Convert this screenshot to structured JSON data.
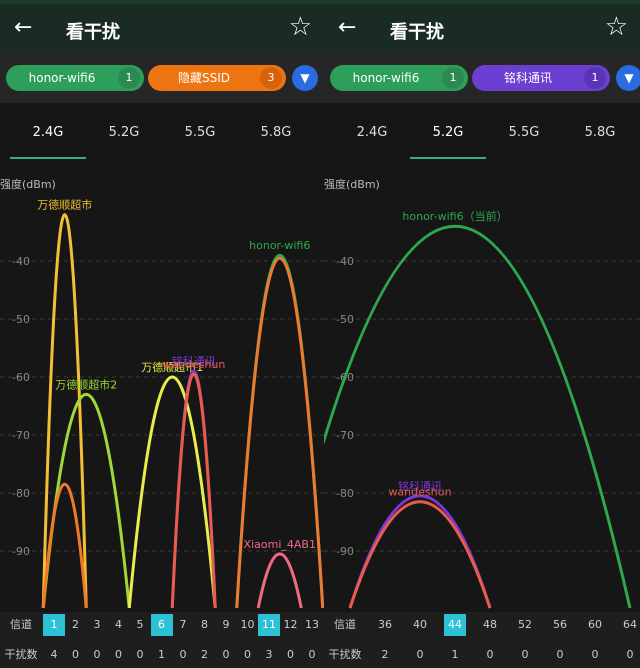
{
  "left": {
    "title": "看干扰",
    "chips": [
      {
        "label": "honor-wifi6",
        "count": "1",
        "color": "#2e9e5b",
        "badge": "#2b8a51"
      },
      {
        "label": "隐藏SSID",
        "count": "3",
        "color": "#ee7411",
        "badge": "#d6620a"
      }
    ],
    "tabs": [
      "2.4G",
      "5.2G",
      "5.5G",
      "5.8G"
    ],
    "active_tab": 0,
    "chart_data": {
      "type": "area",
      "ylabel": "强度(dBm)",
      "y_ticks": [
        "-40",
        "-50",
        "-60",
        "-70",
        "-80",
        "-90"
      ],
      "series": [
        {
          "name": "万德顺超市",
          "center": 1.5,
          "width": 2,
          "peak": -32,
          "color": "#f2c034"
        },
        {
          "name": "万德顺超市2",
          "center": 2.5,
          "width": 4,
          "peak": -63,
          "color": "#9ed839"
        },
        {
          "name": "",
          "center": 1.5,
          "width": 2,
          "peak": -78.5,
          "color": "#f07a28"
        },
        {
          "name": "万德顺超市1",
          "center": 6.5,
          "width": 4,
          "peak": -60,
          "color": "#e8ed4a"
        },
        {
          "name": "铭科通讯",
          "center": 7.5,
          "width": 2,
          "peak": -59,
          "color": "#7a38d8"
        },
        {
          "name": "wandeshun",
          "center": 7.5,
          "width": 2,
          "peak": -59.5,
          "color": "#e85c4a"
        },
        {
          "name": "honor-wifi6",
          "center": 11.5,
          "width": 4,
          "peak": -39,
          "color": "#2da84f"
        },
        {
          "name": "",
          "center": 11.5,
          "width": 4,
          "peak": -39.5,
          "color": "#ec7a30"
        },
        {
          "name": "Xiaomi_4AB1",
          "center": 11.5,
          "width": 2,
          "peak": -90.5,
          "color": "#f06a86"
        }
      ]
    },
    "row1_label": "信道",
    "row2_label": "干扰数",
    "channels": [
      "1",
      "2",
      "3",
      "4",
      "5",
      "6",
      "7",
      "8",
      "9",
      "10",
      "11",
      "12",
      "13"
    ],
    "interference": [
      "4",
      "0",
      "0",
      "0",
      "0",
      "1",
      "0",
      "2",
      "0",
      "0",
      "3",
      "0",
      "0"
    ],
    "highlight": [
      0,
      5,
      10
    ]
  },
  "right": {
    "title": "看干扰",
    "chips": [
      {
        "label": "honor-wifi6",
        "count": "1",
        "color": "#2e9e5b",
        "badge": "#2b8a51"
      },
      {
        "label": "铭科通讯",
        "count": "1",
        "color": "#6b3fd0",
        "badge": "#5c32b8"
      }
    ],
    "tabs": [
      "2.4G",
      "5.2G",
      "5.5G",
      "5.8G"
    ],
    "active_tab": 1,
    "chart_data": {
      "type": "area",
      "ylabel": "强度(dBm)",
      "y_ticks": [
        "-40",
        "-50",
        "-60",
        "-70",
        "-80",
        "-90"
      ],
      "series": [
        {
          "name": "honor-wifi6（当前）",
          "center": 44,
          "width": 40,
          "peak": -34,
          "color": "#2da84f"
        },
        {
          "name": "铭科通讯",
          "center": 40,
          "width": 16,
          "peak": -80.5,
          "color": "#7a38d8"
        },
        {
          "name": "wandeshun",
          "center": 40,
          "width": 16,
          "peak": -81.5,
          "color": "#e85c4a"
        }
      ]
    },
    "row1_label": "信道",
    "row2_label": "干扰数",
    "channels": [
      "36",
      "40",
      "44",
      "48",
      "52",
      "56",
      "60",
      "64"
    ],
    "interference": [
      "2",
      "0",
      "1",
      "0",
      "0",
      "0",
      "0",
      "0"
    ],
    "highlight": [
      2
    ]
  }
}
